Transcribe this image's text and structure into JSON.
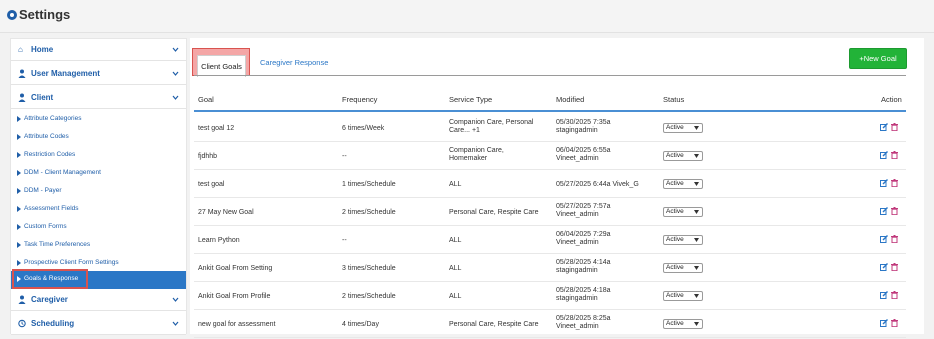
{
  "app": {
    "title": "Settings"
  },
  "sidebar": {
    "items": [
      {
        "label": "Home",
        "icon": "home-icon"
      },
      {
        "label": "User Management",
        "icon": "user-icon"
      },
      {
        "label": "Client",
        "icon": "user-icon"
      },
      {
        "label": "Caregiver",
        "icon": "user-icon"
      },
      {
        "label": "Scheduling",
        "icon": "clock-icon"
      }
    ],
    "client_sub": [
      "Attribute Categories",
      "Attribute Codes",
      "Restriction Codes",
      "DDM - Client Management",
      "DDM - Payer",
      "Assessment Fields",
      "Custom Forms",
      "Task Time Preferences",
      "Prospective Client Form Settings",
      "Goals & Response"
    ],
    "active_sub": "Goals & Response"
  },
  "tabs": [
    {
      "label": "Client Goals",
      "active": true
    },
    {
      "label": "Caregiver Response",
      "active": false
    }
  ],
  "new_button": "+New Goal",
  "table": {
    "headers": [
      "Goal",
      "Frequency",
      "Service Type",
      "Modified",
      "Status",
      "Action"
    ],
    "rows": [
      {
        "goal": "test goal 12",
        "frequency": "6 times/Week",
        "service": [
          "Companion Care, Personal",
          "Care... +1"
        ],
        "modified": [
          "05/30/2025 7:35a",
          "stagingadmin"
        ],
        "status": "Active"
      },
      {
        "goal": "fjdhhb",
        "frequency": "--",
        "service": [
          "Companion Care,",
          "Homemaker"
        ],
        "modified": [
          "06/04/2025 6:55a",
          "Vineet_admin"
        ],
        "status": "Active"
      },
      {
        "goal": "test goal",
        "frequency": "1 times/Schedule",
        "service": [
          "ALL"
        ],
        "modified": [
          "05/27/2025 6:44a Vivek_G"
        ],
        "status": "Active"
      },
      {
        "goal": "27 May New Goal",
        "frequency": "2 times/Schedule",
        "service": [
          "Personal Care, Respite Care"
        ],
        "modified": [
          "05/27/2025 7:57a",
          "Vineet_admin"
        ],
        "status": "Active"
      },
      {
        "goal": "Learn Python",
        "frequency": "--",
        "service": [
          "ALL"
        ],
        "modified": [
          "06/04/2025 7:29a",
          "Vineet_admin"
        ],
        "status": "Active"
      },
      {
        "goal": "Ankit Goal From Setting",
        "frequency": "3 times/Schedule",
        "service": [
          "ALL"
        ],
        "modified": [
          "05/28/2025 4:14a",
          "stagingadmin"
        ],
        "status": "Active"
      },
      {
        "goal": "Ankit Goal From Profile",
        "frequency": "2 times/Schedule",
        "service": [
          "ALL"
        ],
        "modified": [
          "05/28/2025 4:18a",
          "stagingadmin"
        ],
        "status": "Active"
      },
      {
        "goal": "new goal for assessment",
        "frequency": "4 times/Day",
        "service": [
          "Personal Care, Respite Care"
        ],
        "modified": [
          "05/28/2025 8:25a",
          "Vineet_admin"
        ],
        "status": "Active"
      }
    ]
  },
  "colors": {
    "link_blue": "#1f5ea8",
    "active_bg": "#2b77c6",
    "button_green": "#22b338",
    "highlight_red": "#d9534f"
  }
}
